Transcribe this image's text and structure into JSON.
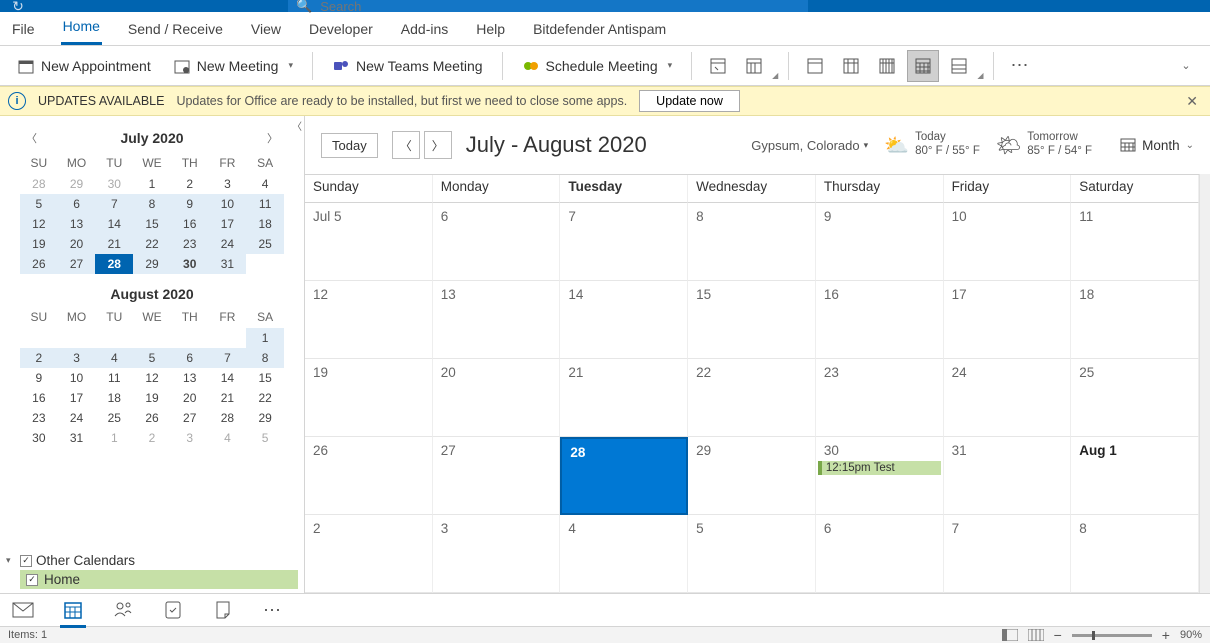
{
  "titlebar": {
    "search_placeholder": "Search"
  },
  "tabs": {
    "file": "File",
    "home": "Home",
    "sendreceive": "Send / Receive",
    "view": "View",
    "developer": "Developer",
    "addins": "Add-ins",
    "help": "Help",
    "bitdefender": "Bitdefender Antispam"
  },
  "ribbon": {
    "new_appointment": "New Appointment",
    "new_meeting": "New Meeting",
    "new_teams_meeting": "New Teams Meeting",
    "schedule_meeting": "Schedule Meeting"
  },
  "notice": {
    "title": "UPDATES AVAILABLE",
    "text": "Updates for Office are ready to be installed, but first we need to close some apps.",
    "button": "Update now"
  },
  "minical1": {
    "title": "July 2020",
    "dow": [
      "SU",
      "MO",
      "TU",
      "WE",
      "TH",
      "FR",
      "SA"
    ],
    "rows": [
      [
        "28",
        "29",
        "30",
        "1",
        "2",
        "3",
        "4"
      ],
      [
        "5",
        "6",
        "7",
        "8",
        "9",
        "10",
        "11"
      ],
      [
        "12",
        "13",
        "14",
        "15",
        "16",
        "17",
        "18"
      ],
      [
        "19",
        "20",
        "21",
        "22",
        "23",
        "24",
        "25"
      ],
      [
        "26",
        "27",
        "28",
        "29",
        "30",
        "31"
      ]
    ]
  },
  "minical2": {
    "title": "August 2020",
    "dow": [
      "SU",
      "MO",
      "TU",
      "WE",
      "TH",
      "FR",
      "SA"
    ],
    "rows": [
      [
        "",
        "",
        "",
        "",
        "",
        "",
        "1"
      ],
      [
        "2",
        "3",
        "4",
        "5",
        "6",
        "7",
        "8"
      ],
      [
        "9",
        "10",
        "11",
        "12",
        "13",
        "14",
        "15"
      ],
      [
        "16",
        "17",
        "18",
        "19",
        "20",
        "21",
        "22"
      ],
      [
        "23",
        "24",
        "25",
        "26",
        "27",
        "28",
        "29"
      ],
      [
        "30",
        "31",
        "1",
        "2",
        "3",
        "4",
        "5"
      ]
    ]
  },
  "othercals": {
    "header": "Other Calendars",
    "home": "Home"
  },
  "calheader": {
    "today": "Today",
    "period": "July - August 2020",
    "location": "Gypsum, Colorado",
    "w_today_lbl": "Today",
    "w_today_tmp": "80° F / 55° F",
    "w_tom_lbl": "Tomorrow",
    "w_tom_tmp": "85° F / 54° F",
    "month": "Month"
  },
  "dayheads": [
    "Sunday",
    "Monday",
    "Tuesday",
    "Wednesday",
    "Thursday",
    "Friday",
    "Saturday"
  ],
  "grid": [
    [
      "Jul 5",
      "6",
      "7",
      "8",
      "9",
      "10",
      "11"
    ],
    [
      "12",
      "13",
      "14",
      "15",
      "16",
      "17",
      "18"
    ],
    [
      "19",
      "20",
      "21",
      "22",
      "23",
      "24",
      "25"
    ],
    [
      "26",
      "27",
      "28",
      "29",
      "30",
      "31",
      "Aug 1"
    ],
    [
      "2",
      "3",
      "4",
      "5",
      "6",
      "7",
      "8"
    ]
  ],
  "event": "12:15pm Test",
  "status": {
    "items": "Items: 1",
    "zoom": "90%"
  }
}
